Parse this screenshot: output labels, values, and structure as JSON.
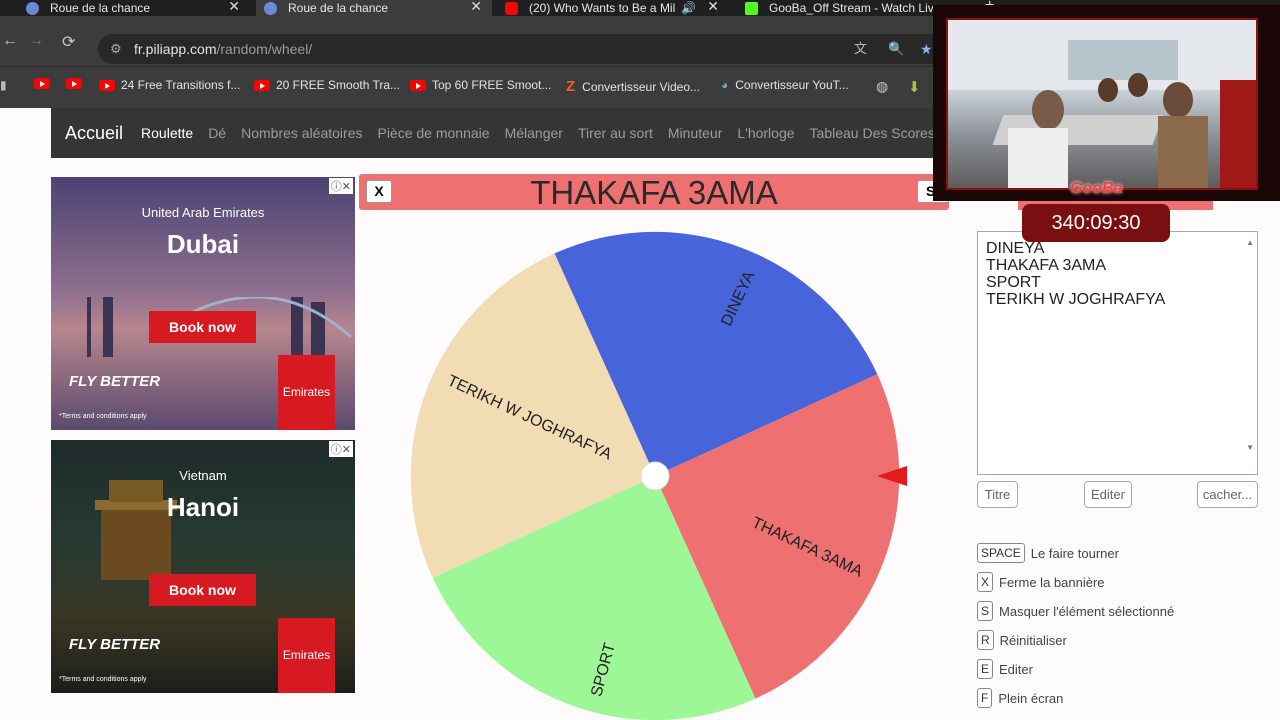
{
  "browser": {
    "tabs": [
      {
        "title": "Roue de la chance",
        "active": false,
        "favicon_color": "#6b8ad6"
      },
      {
        "title": "Roue de la chance",
        "active": true,
        "favicon_color": "#6b8ad6"
      },
      {
        "title": "(20) Who Wants to Be a Mil",
        "active": false,
        "favicon_color": "#ff0000"
      },
      {
        "title": "GooBa_Off Stream - Watch Live",
        "active": false,
        "favicon_color": "#53fc18"
      }
    ],
    "url_domain": "fr.piliapp.com",
    "url_path": "/random/wheel/",
    "bookmarks": [
      {
        "label": "",
        "icon": "youtube-icon"
      },
      {
        "label": "",
        "icon": "youtube-icon"
      },
      {
        "label": "24 Free Transitions f...",
        "icon": "youtube-icon"
      },
      {
        "label": "20 FREE Smooth Tra...",
        "icon": "youtube-icon"
      },
      {
        "label": "Top 60 FREE Smoot...",
        "icon": "youtube-icon"
      },
      {
        "label": "Convertisseur Video...",
        "icon": "z-icon"
      },
      {
        "label": "Convertisseur YouT...",
        "icon": "converter-icon"
      },
      {
        "label": "",
        "icon": "globe-icon"
      },
      {
        "label": "",
        "icon": "download-icon"
      }
    ]
  },
  "site": {
    "brand": "Accueil",
    "nav": [
      "Roulette",
      "Dé",
      "Nombres aléatoires",
      "Pièce de monnaie",
      "Mélanger",
      "Tirer au sort",
      "Minuteur",
      "L'horloge",
      "Tableau Des Scores"
    ],
    "active_nav": "Roulette"
  },
  "ads": [
    {
      "country": "United Arab Emirates",
      "city": "Dubai",
      "cta": "Book now",
      "slogan": "FLY BETTER",
      "brand": "Emirates",
      "terms": "*Terms and conditions apply"
    },
    {
      "country": "Vietnam",
      "city": "Hanoi",
      "cta": "Book now",
      "slogan": "FLY BETTER",
      "brand": "Emirates",
      "terms": "*Terms and conditions apply"
    }
  ],
  "result": {
    "title": "THAKAFA 3AMA",
    "close_label": "X",
    "s_label": "S",
    "color": "#ee7070"
  },
  "wheel": {
    "segments": [
      {
        "label": "DINEYA",
        "color": "#4764db"
      },
      {
        "label": "THAKAFA 3AMA",
        "color": "#ee7070"
      },
      {
        "label": "SPORT",
        "color": "#9ef797"
      },
      {
        "label": "TERIKH W JOGHRAFYA",
        "color": "#f2dcb3"
      }
    ],
    "pointer_color": "#e31b1b"
  },
  "editor": {
    "lines": [
      "DINEYA",
      "THAKAFA 3AMA",
      "SPORT",
      "TERIKH W JOGHRAFYA"
    ],
    "buttons": {
      "title": "Titre",
      "edit": "Editer",
      "hide": "cacher..."
    }
  },
  "shortcuts": [
    {
      "key": "SPACE",
      "label": "Le faire tourner"
    },
    {
      "key": "X",
      "label": "Ferme la bannière"
    },
    {
      "key": "S",
      "label": "Masquer l'élément sélectionné"
    },
    {
      "key": "R",
      "label": "Réinitialiser"
    },
    {
      "key": "E",
      "label": "Editer"
    },
    {
      "key": "F",
      "label": "Plein écran"
    }
  ],
  "stream_overlay": {
    "channel": "GooBa",
    "timer": "340:09:30"
  }
}
